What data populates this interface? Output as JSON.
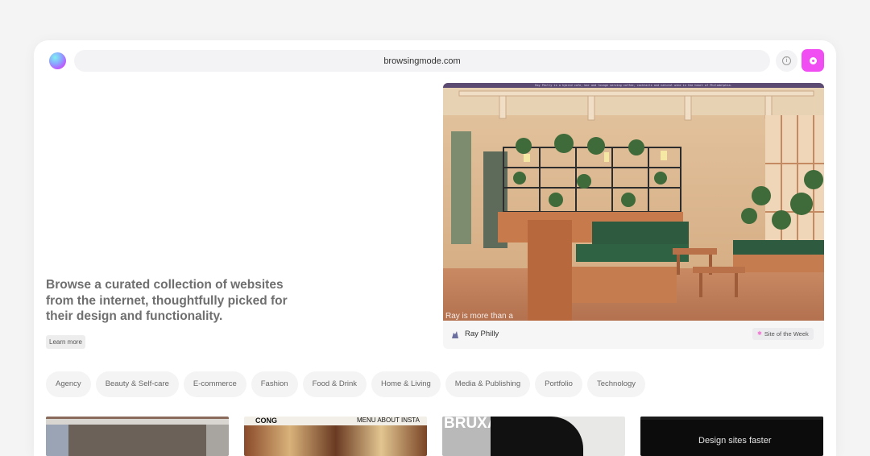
{
  "browser": {
    "url": "browsingmode.com",
    "logo_icon": "gradient-orb-logo",
    "info_icon": "info-icon",
    "action_icon": "record-icon",
    "accent_color": "#f04ef2"
  },
  "hero": {
    "tagline": "Browse a curated collection of websites from the internet, thoughtfully picked for their design and functionality.",
    "learn_more_label": "Learn more"
  },
  "featured": {
    "banner_text": "Ray Philly is a hybrid cafe, bar and lounge serving coffee, cocktails and natural wine in the heart of Philadelphia.",
    "caption": "Ray is more than a",
    "author_name": "Ray Philly",
    "author_icon": "puzzle-logo-icon",
    "badge_label": "Site of the Week",
    "badge_icon": "star-icon"
  },
  "categories": [
    {
      "label": "Agency"
    },
    {
      "label": "Beauty & Self-care"
    },
    {
      "label": "E-commerce"
    },
    {
      "label": "Fashion"
    },
    {
      "label": "Food & Drink"
    },
    {
      "label": "Home & Living"
    },
    {
      "label": "Media & Publishing"
    },
    {
      "label": "Portfolio"
    },
    {
      "label": "Technology"
    }
  ],
  "thumbnails": [
    {
      "name": "thumb-1",
      "text": ""
    },
    {
      "name": "thumb-2",
      "brand": "CONG",
      "nav": "MENU ABOUT INSTA"
    },
    {
      "name": "thumb-3",
      "brand": "BRUXA"
    },
    {
      "name": "thumb-4",
      "headline": "Design sites faster"
    }
  ]
}
